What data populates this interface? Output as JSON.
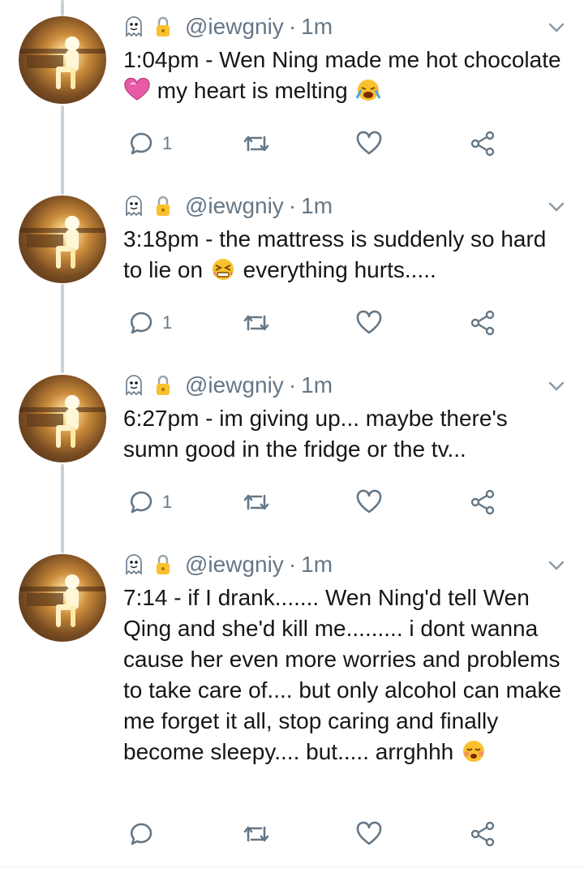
{
  "tweets": [
    {
      "handle": "@iewgniy",
      "separator": "·",
      "time": "1m",
      "text_a": "1:04pm - Wen Ning made me hot chocolate ",
      "emoji_a": "heart",
      "text_b": " my heart is melting ",
      "emoji_b": "crying-face",
      "reply_count": "1"
    },
    {
      "handle": "@iewgniy",
      "separator": "·",
      "time": "1m",
      "text_a": "3:18pm - the mattress is suddenly so hard to lie on ",
      "emoji_a": "tired-face",
      "text_b": " everything hurts.....",
      "reply_count": "1"
    },
    {
      "handle": "@iewgniy",
      "separator": "·",
      "time": "1m",
      "text_a": "6:27pm - im giving up... maybe there's sumn good in the fridge or the tv...",
      "reply_count": "1"
    },
    {
      "handle": "@iewgniy",
      "separator": "·",
      "time": "1m",
      "text_a": "7:14 - if I drank....... Wen Ning'd tell Wen Qing and she'd kill me......... i dont wanna cause her even more worries and problems to take care of.... but only alcohol can make me forget it all, stop caring and finally become sleepy.... but..... arrghhh ",
      "emoji_a": "flushed-sad-face",
      "reply_count": ""
    }
  ],
  "colors": {
    "text": "#14171a",
    "muted": "#657786",
    "thread_line": "#c8d2da",
    "heart_emoji": "#e85aa5",
    "emoji_yellow": "#f9c12e"
  },
  "icons": [
    "ghost-icon",
    "lock-icon",
    "chevron-down-icon",
    "reply-icon",
    "retweet-icon",
    "like-icon",
    "share-icon"
  ]
}
